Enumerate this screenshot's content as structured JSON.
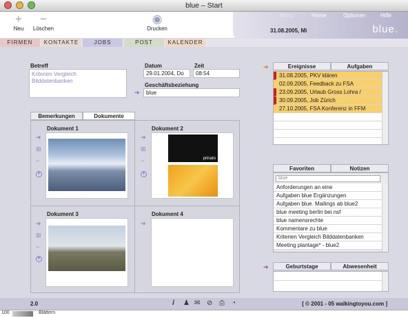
{
  "window": {
    "title": "blue – Start"
  },
  "toolbar": {
    "new_label": "Neu",
    "delete_label": "Löschen",
    "print_label": "Drucken",
    "new_icon": "plus-icon",
    "delete_icon": "minus-icon",
    "print_icon": "target-icon"
  },
  "topnav": {
    "items": [
      "Menu",
      "Home",
      "Optionen",
      "Hilfe"
    ]
  },
  "brand": "blue.",
  "date": "31.08.2005, Mi",
  "tabs": [
    {
      "label": "FIRMEN",
      "color": "#e6c7c6"
    },
    {
      "label": "KONTAKTE",
      "color": "#e9d9d3"
    },
    {
      "label": "JOBS",
      "color": "#c9c7e3"
    },
    {
      "label": "POST",
      "color": "#d3dcc7"
    },
    {
      "label": "KALENDER",
      "color": "#eed9c4"
    }
  ],
  "form": {
    "betreff_label": "Betreff",
    "betreff_value": "Kriterien Vergleich Bilddatenbanken",
    "datum_label": "Datum",
    "datum_value": "29.01.2004, Do",
    "zeit_label": "Zeit",
    "zeit_value": "08:54",
    "beziehung_label": "Geschäftsbeziehung",
    "beziehung_value": "blue"
  },
  "panel": {
    "tabs": [
      "Bemerkungen",
      "Dokumente"
    ],
    "documents": [
      "Dokument 1",
      "Dokument 2",
      "Dokument 3",
      "Dokument 4"
    ],
    "doc2_caption": "prinato"
  },
  "ereignisse": {
    "tabs": [
      "Ereignisse",
      "Aufgaben"
    ],
    "rows": [
      {
        "text": "31.08.2005, PKV klären",
        "flag": true
      },
      {
        "text": "02.09.2005, Feedback zu FSA",
        "flag": false
      },
      {
        "text": "23.09.2005, Urlaub Gross Lohra /",
        "flag": true
      },
      {
        "text": "30.09.2005, Job Zürich",
        "flag": true
      },
      {
        "text": "27.10.2005, FSA Konferenz in FFM",
        "flag": false
      }
    ]
  },
  "favoriten": {
    "tabs": [
      "Favoriten",
      "Notizen"
    ],
    "search_value": "blue",
    "rows": [
      "Anforderungen an eine",
      "Aufgaben blue Ergänzungen",
      "Aufgaben blue. Mailings ab blue2",
      "blue meeting berlin bei nsf",
      "blue namensrechte",
      "Kommentare zu blue",
      "Kriterien Vergleich Bilddatenbanken",
      "Meeting plantage* - blue2"
    ]
  },
  "geburtstage": {
    "tabs": [
      "Geburtstage",
      "Abwesenheit"
    ]
  },
  "status": {
    "version": "2.0",
    "copyright": "[ © 2001 - 05 walkingtoyou.com ]",
    "icons": [
      "info-icon",
      "user-icon",
      "mail-icon",
      "link-icon",
      "print-icon",
      "clock-icon"
    ]
  },
  "bottom": {
    "zoom": "100",
    "label": "Blättern"
  }
}
